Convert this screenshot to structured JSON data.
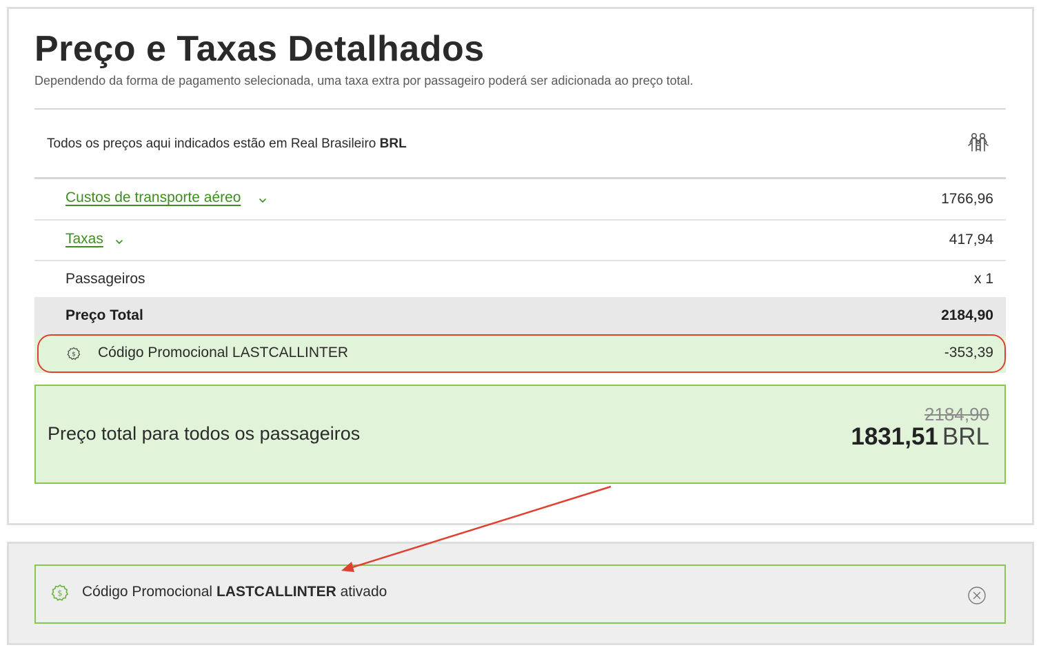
{
  "header": {
    "title": "Preço e Taxas Detalhados",
    "subtitle": "Dependendo da forma de pagamento selecionada, uma taxa extra por passageiro poderá ser adicionada ao preço total."
  },
  "currency_note": {
    "text": "Todos os preços aqui indicados estão em Real Brasileiro",
    "currency_code": "BRL",
    "icon": "family-icon"
  },
  "breakdown": {
    "air_transport": {
      "label": "Custos de transporte aéreo",
      "value": "1766,96"
    },
    "taxes": {
      "label": "Taxas",
      "value": "417,94"
    },
    "passengers": {
      "label": "Passageiros",
      "value": "x 1"
    },
    "total": {
      "label": "Preço Total",
      "value": "2184,90"
    },
    "promo": {
      "label": "Código Promocional LASTCALLINTER",
      "value": "-353,39",
      "icon": "promo-badge-icon"
    }
  },
  "total_box": {
    "label": "Preço total para todos os passageiros",
    "old_price": "2184,90",
    "new_price": "1831,51",
    "currency": "BRL"
  },
  "notice": {
    "prefix": "Código Promocional",
    "code": "LASTCALLINTER",
    "suffix": "ativado",
    "icon": "promo-badge-icon"
  },
  "colors": {
    "link_green": "#3e8e1f",
    "promo_bg": "#e1f3d9",
    "promo_border": "#86c653",
    "highlight_red": "#e0402f",
    "total_row_bg": "#e8e8e8"
  }
}
